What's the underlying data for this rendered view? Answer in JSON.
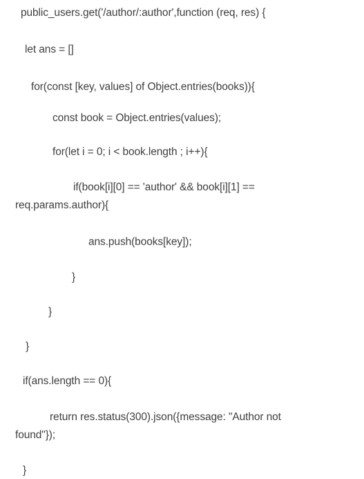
{
  "code_lines": [
    "public_users.get('/author/:author',function (req, res) {",
    "let ans = []",
    "for(const [key, values] of Object.entries(books)){",
    "const book = Object.entries(values);",
    "for(let i = 0; i < book.length ; i++){",
    "if(book[i][0] == 'author' && book[i][1] ==",
    "req.params.author){",
    "ans.push(books[key]);",
    "}",
    "}",
    "}",
    "if(ans.length == 0){",
    "return res.status(300).json({message: \"Author not",
    "found\"});",
    "}"
  ]
}
